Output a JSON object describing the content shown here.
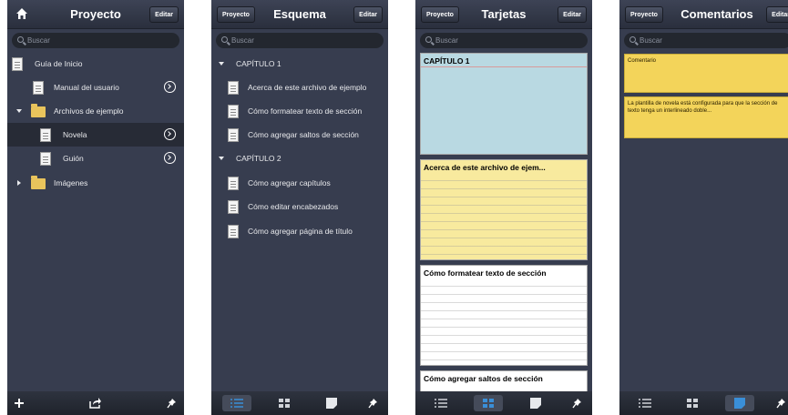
{
  "proyecto": {
    "title": "Proyecto",
    "edit_label": "Editar",
    "search_placeholder": "Buscar",
    "items": [
      {
        "label": "Guía de Inicio"
      },
      {
        "label": "Manual del usuario"
      },
      {
        "label": "Archivos de ejemplo"
      },
      {
        "label": "Novela"
      },
      {
        "label": "Guión"
      },
      {
        "label": "Imágenes"
      }
    ]
  },
  "esquema": {
    "title": "Esquema",
    "back_label": "Proyecto",
    "edit_label": "Editar",
    "search_placeholder": "Buscar",
    "chapters": [
      {
        "label": "CAPÍTULO 1",
        "items": [
          "Acerca de este archivo de ejemplo",
          "Cómo formatear texto de sección",
          "Cómo agregar saltos de sección"
        ]
      },
      {
        "label": "CAPÍTULO 2",
        "items": [
          "Cómo agregar capítulos",
          "Cómo editar encabezados",
          "Cómo agregar página de título"
        ]
      }
    ]
  },
  "tarjetas": {
    "title": "Tarjetas",
    "back_label": "Proyecto",
    "edit_label": "Editar",
    "search_placeholder": "Buscar",
    "cards": [
      {
        "title": "CAPÍTULO 1",
        "color": "#b9d9e2"
      },
      {
        "title": "Acerca de este archivo de ejem...",
        "color": "#f8ea9e"
      },
      {
        "title": "Cómo formatear texto de sección",
        "color": "#ffffff"
      },
      {
        "title": "Cómo agregar saltos de sección",
        "color": "#ffffff"
      }
    ]
  },
  "comentarios": {
    "title": "Comentarios",
    "back_label": "Proyecto",
    "edit_label": "Editar",
    "search_placeholder": "Buscar",
    "notes": [
      {
        "text": "Comentario"
      },
      {
        "text": "La plantilla de novela está configurada para que la sección de texto tenga un interlineado doble..."
      }
    ]
  },
  "colors": {
    "panel": "#373d4f",
    "toolbar_active": "#454b5a",
    "folder": "#e9c45c",
    "note": "#f3d45a"
  },
  "icons": [
    "home-icon",
    "add-icon",
    "share-icon",
    "pin-icon",
    "list-icon",
    "grid-icon",
    "note-icon",
    "disclosure-icon",
    "document-icon",
    "folder-icon"
  ]
}
